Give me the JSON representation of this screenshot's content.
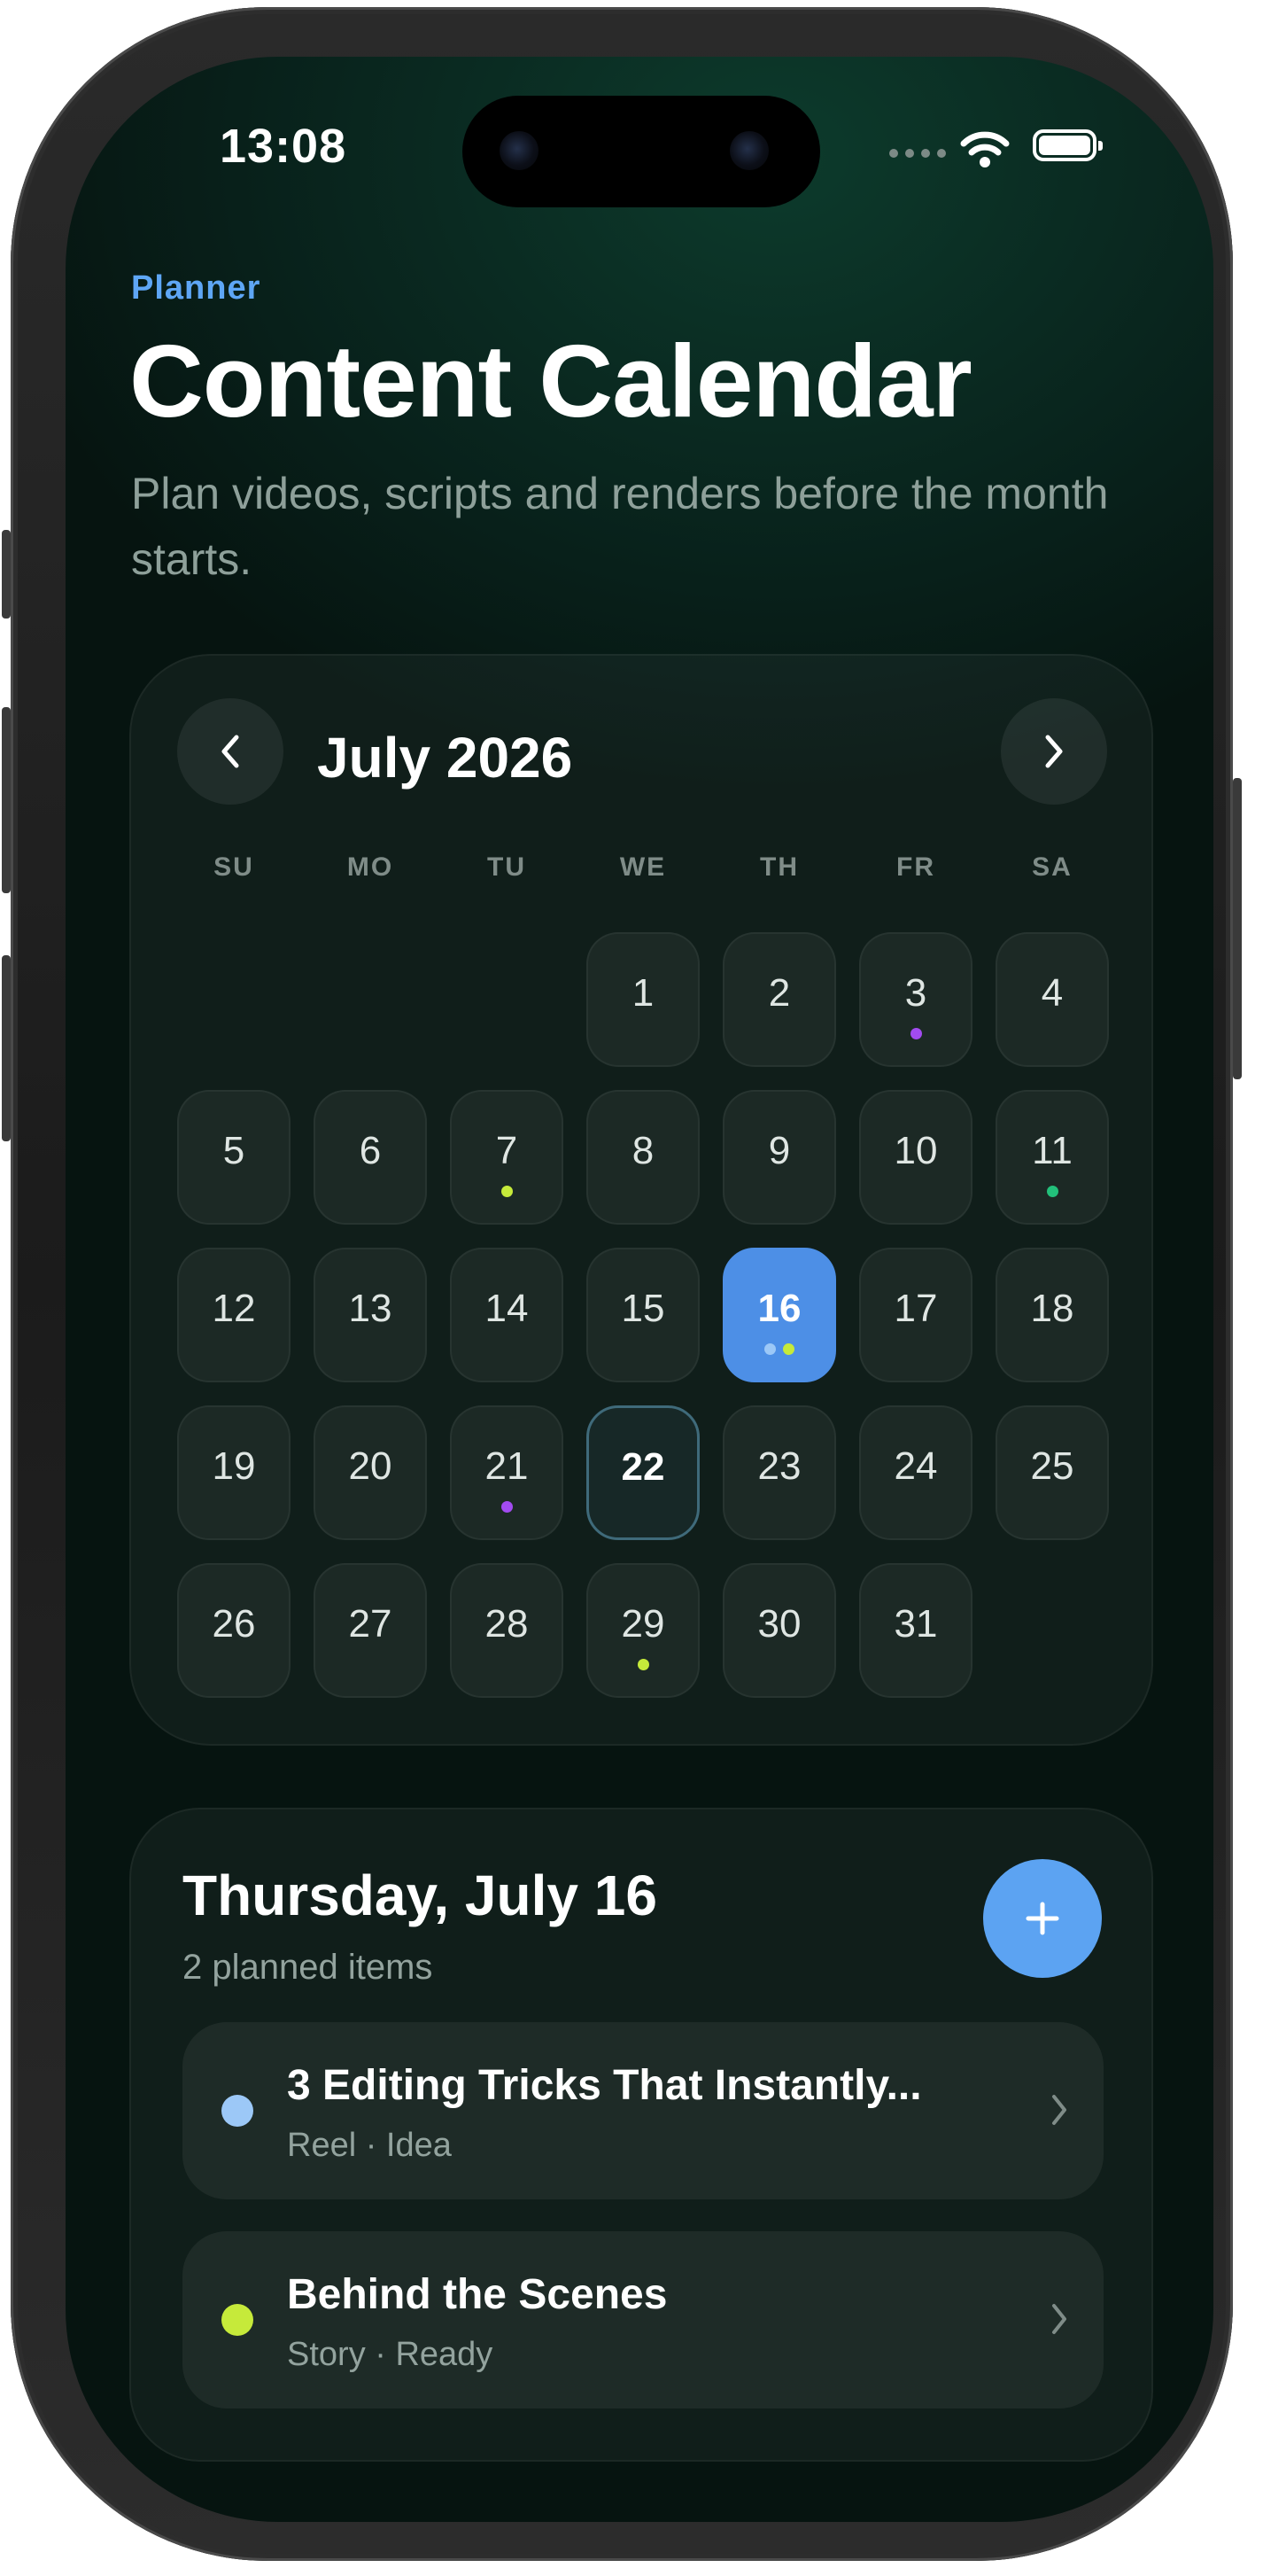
{
  "status_bar": {
    "time": "13:08"
  },
  "header": {
    "eyebrow": "Planner",
    "title": "Content Calendar",
    "subtitle": "Plan videos, scripts and renders before the month starts."
  },
  "calendar": {
    "month_label": "July 2026",
    "weekdays": [
      "SU",
      "MO",
      "TU",
      "WE",
      "TH",
      "FR",
      "SA"
    ],
    "first_weekday_index": 3,
    "days_in_month": 31,
    "selected_day": 16,
    "today_day": 22,
    "event_dots": {
      "3": [
        "#a24bf0"
      ],
      "7": [
        "#c6ea3a"
      ],
      "11": [
        "#22c07a"
      ],
      "16": [
        "#9cc8f7",
        "#c6ea3a"
      ],
      "21": [
        "#a24bf0"
      ],
      "29": [
        "#c6ea3a"
      ]
    },
    "day_labels": [
      "1",
      "2",
      "3",
      "4",
      "5",
      "6",
      "7",
      "8",
      "9",
      "10",
      "11",
      "12",
      "13",
      "14",
      "15",
      "16",
      "17",
      "18",
      "19",
      "20",
      "21",
      "22",
      "23",
      "24",
      "25",
      "26",
      "27",
      "28",
      "29",
      "30",
      "31"
    ]
  },
  "agenda": {
    "title": "Thursday, July 16",
    "count_label": "2 planned items",
    "items": [
      {
        "title": "3 Editing Tricks That Instantly...",
        "meta": "Reel · Idea",
        "dot_color": "#9cc8f7"
      },
      {
        "title": "Behind the Scenes",
        "meta": "Story · Ready",
        "dot_color": "#c6ea3a"
      }
    ]
  }
}
